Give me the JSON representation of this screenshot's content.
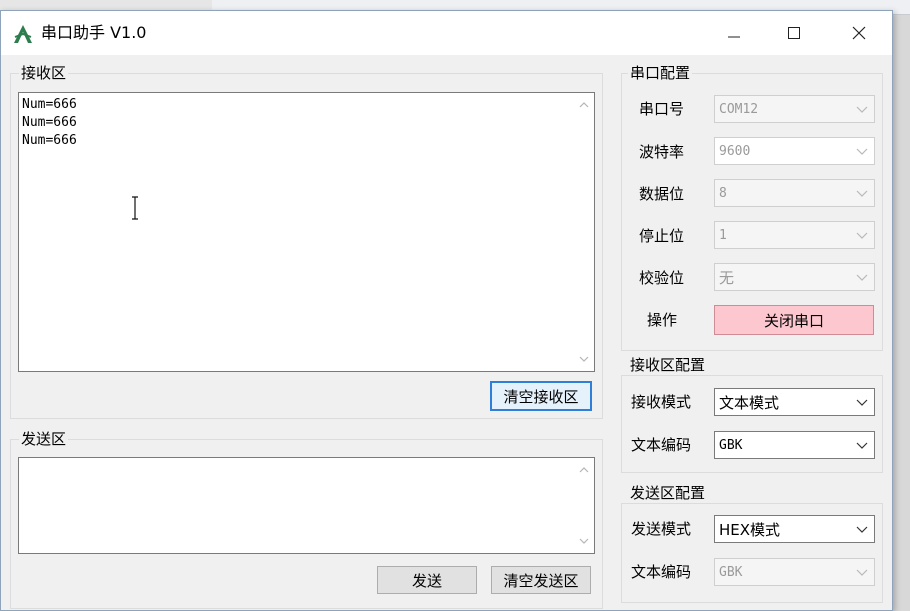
{
  "window": {
    "title": "串口助手 V1.0"
  },
  "receive_area": {
    "label": "接收区",
    "lines": [
      "Num=666",
      "Num=666",
      "Num=666"
    ],
    "clear_button": "清空接收区"
  },
  "send_area": {
    "label": "发送区",
    "text": "",
    "send_button": "发送",
    "clear_button": "清空发送区"
  },
  "serial_config": {
    "label": "串口配置",
    "port_label": "串口号",
    "port_value": "COM12",
    "baud_label": "波特率",
    "baud_value": "9600",
    "databits_label": "数据位",
    "databits_value": "8",
    "stopbits_label": "停止位",
    "stopbits_value": "1",
    "parity_label": "校验位",
    "parity_value": "无",
    "operation_label": "操作",
    "operation_button": "关闭串口"
  },
  "receive_config": {
    "label": "接收区配置",
    "mode_label": "接收模式",
    "mode_value": "文本模式",
    "encoding_label": "文本编码",
    "encoding_value": "GBK"
  },
  "send_config": {
    "label": "发送区配置",
    "mode_label": "发送模式",
    "mode_value": "HEX模式",
    "encoding_label": "文本编码",
    "encoding_value": "GBK"
  },
  "colors": {
    "close_button_bg": "#fcc7cf",
    "focus_border": "#2f7ed8",
    "app_icon": "#2e7d4f"
  }
}
